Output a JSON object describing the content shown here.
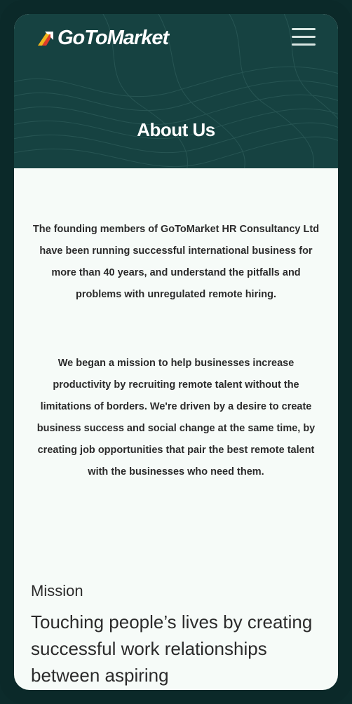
{
  "header": {
    "logo_text": "GoToMarket",
    "title": "About Us"
  },
  "about": {
    "paragraph_1": "The founding members of GoToMarket HR Consultancy Ltd have been running successful international business for more than 40 years, and understand the pitfalls and problems with unregulated remote hiring.",
    "paragraph_2": "We began a mission to help businesses increase productivity by recruiting remote talent without the limitations of borders. We're driven by a desire to create business success and social change at the same time, by creating job opportunities that pair the best remote talent with the businesses who need them."
  },
  "mission": {
    "label": "Mission",
    "text": "Touching people’s lives by creating successful work relationships between aspiring"
  },
  "colors": {
    "hero_bg": "#164241",
    "frame": "#0b2929",
    "page_bg": "#f6fbf8",
    "logo_red": "#e03a2a",
    "logo_yellow": "#f2b51c"
  },
  "icons": {
    "menu": "hamburger-menu-icon",
    "logo": "gotomarket-logo-mark"
  }
}
